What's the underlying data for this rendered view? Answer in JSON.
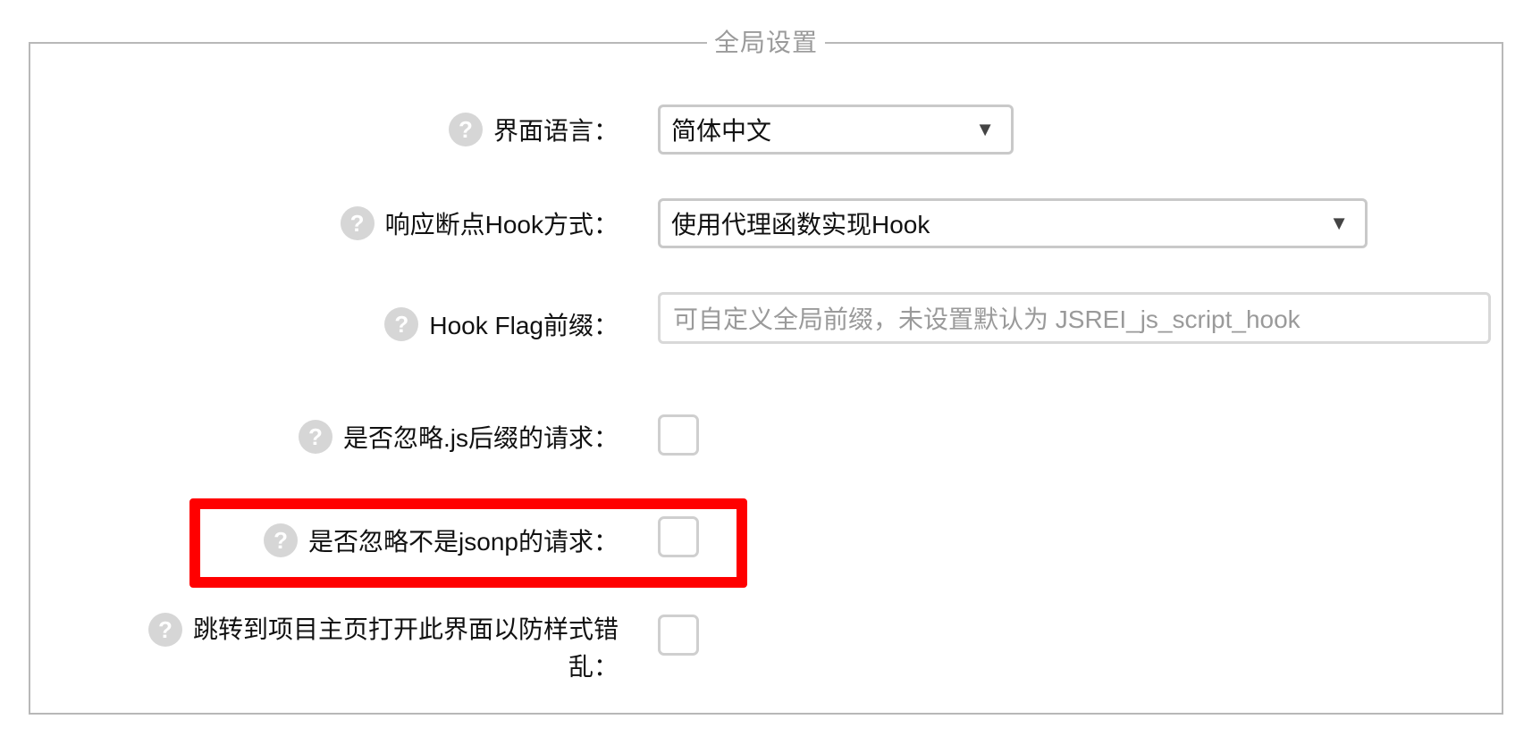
{
  "fieldset": {
    "legend": "全局设置"
  },
  "settings": {
    "language": {
      "label": "界面语言：",
      "value": "简体中文"
    },
    "hook_method": {
      "label": "响应断点Hook方式：",
      "value": "使用代理函数实现Hook"
    },
    "hook_prefix": {
      "label": "Hook Flag前缀：",
      "value": "",
      "placeholder": "可自定义全局前缀，未设置默认为 JSREI_js_script_hook"
    },
    "ignore_js_suffix": {
      "label": "是否忽略.js后缀的请求：",
      "checked": false
    },
    "ignore_non_jsonp": {
      "label": "是否忽略不是jsonp的请求：",
      "checked": false
    },
    "open_home": {
      "label_line1": "跳转到项目主页打开此界面以防样式错",
      "label_line2": "乱：",
      "checked": false
    }
  },
  "icons": {
    "help": "question-circle-icon",
    "dropdown": "triangle-down-icon"
  },
  "symbols": {
    "help": "?",
    "arrow": "▼"
  },
  "colors": {
    "highlight": "#ff0000",
    "help_icon_bg": "#d6d6d6",
    "border": "#b8b8b8",
    "legend": "#9a9a9a"
  }
}
